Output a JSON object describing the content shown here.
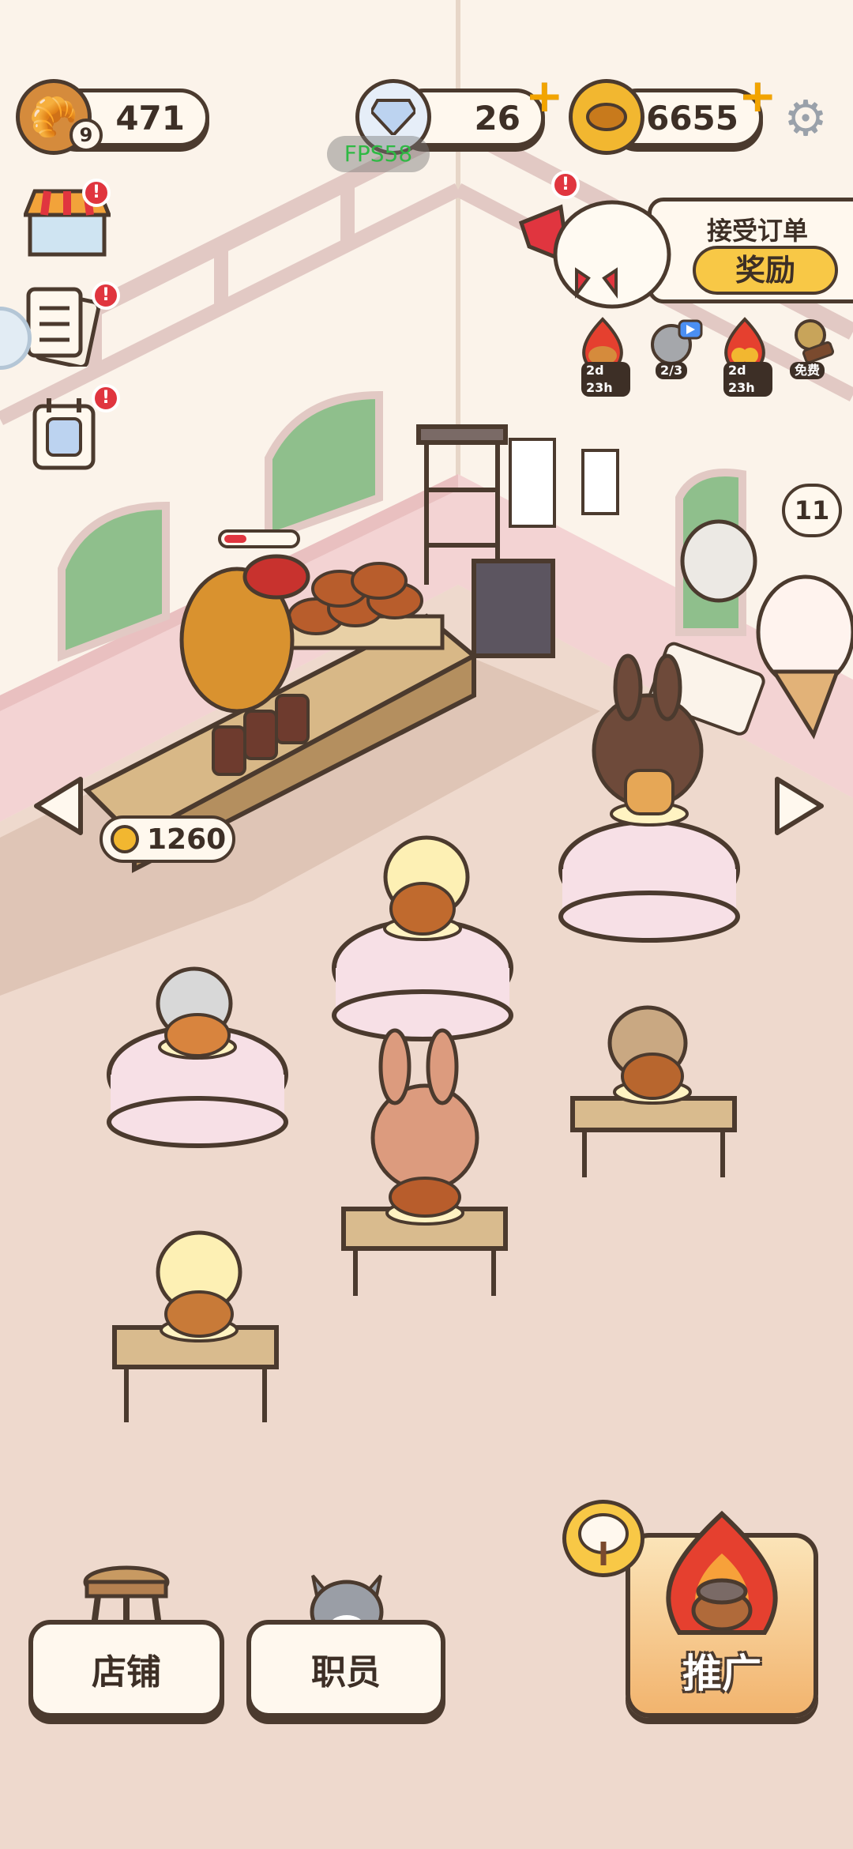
{
  "hud": {
    "bread_count": "471",
    "bread_level": "9",
    "diamonds": "26",
    "coins": "56655",
    "fps_readout": "FPS58"
  },
  "order_panel": {
    "title": "接受订单",
    "reward_label": "奖励"
  },
  "events": [
    {
      "icon": "flame-bread-icon",
      "label": "2d 23h"
    },
    {
      "icon": "video-ad-icon",
      "label": "2/3"
    },
    {
      "icon": "flame-coins-icon",
      "label": "2d 23h"
    },
    {
      "icon": "free-gift-icon",
      "label": "免费"
    }
  ],
  "counter": {
    "coins_collected": "1260"
  },
  "customer_queue": {
    "count": "11"
  },
  "bottom_bar": {
    "shop_label": "店铺",
    "staff_label": "职员",
    "promote_label": "推广"
  },
  "colors": {
    "background": "#eed9cd",
    "outline": "#4b3a2e",
    "button_fill": "#fff8ee",
    "accent_gold": "#f2a400",
    "badge_red": "#e0353f",
    "reward_yellow": "#f8c846"
  }
}
